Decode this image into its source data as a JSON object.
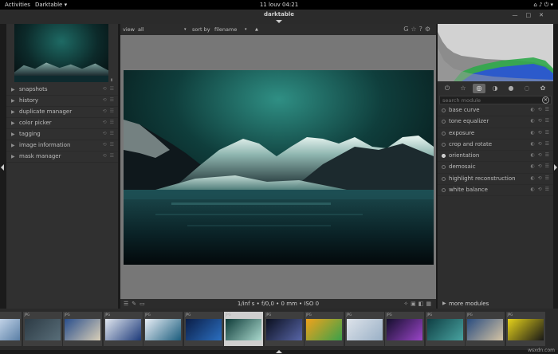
{
  "topbar": {
    "activities": "Activities",
    "app_menu": "Darktable",
    "clock": "11 louv  04:21",
    "tray_icons": [
      "network-icon",
      "volume-icon",
      "power-icon"
    ]
  },
  "window": {
    "title": "darktable",
    "buttons": [
      "minimize-icon",
      "maximize-icon",
      "close-icon"
    ]
  },
  "left_panel": {
    "modules": [
      {
        "label": "snapshots"
      },
      {
        "label": "history"
      },
      {
        "label": "duplicate manager"
      },
      {
        "label": "color picker"
      },
      {
        "label": "tagging"
      },
      {
        "label": "image information"
      },
      {
        "label": "mask manager"
      }
    ]
  },
  "center": {
    "toolbar": {
      "view_label": "view",
      "view_value": "all",
      "sort_label": "sort by",
      "sort_value": "filename"
    },
    "exif_line": "1/inf s • f/0,0 • 0 mm • ISO 0"
  },
  "right_panel": {
    "search_placeholder": "search module",
    "group_tabs": [
      "power-icon",
      "favorites-icon",
      "base-group-icon",
      "tone-group-icon",
      "color-group-icon",
      "correct-group-icon",
      "effect-group-icon"
    ],
    "active_group": 2,
    "modules": [
      {
        "label": "base curve",
        "enabled": false
      },
      {
        "label": "tone equalizer",
        "enabled": false
      },
      {
        "label": "exposure",
        "enabled": false
      },
      {
        "label": "crop and rotate",
        "enabled": false
      },
      {
        "label": "orientation",
        "enabled": true
      },
      {
        "label": "demosaic",
        "enabled": false
      },
      {
        "label": "highlight reconstruction",
        "enabled": false
      },
      {
        "label": "white balance",
        "enabled": false
      }
    ],
    "more_modules": "more modules"
  },
  "filmstrip": {
    "active_index": 6,
    "thumbnails": [
      {
        "ext": "",
        "colors": [
          "#e8f2ff",
          "#5a7fa6"
        ]
      },
      {
        "ext": "JPG",
        "colors": [
          "#2d3b45",
          "#586d78"
        ]
      },
      {
        "ext": "JPG",
        "colors": [
          "#2a4f8c",
          "#d9cfb8"
        ]
      },
      {
        "ext": "JPG",
        "colors": [
          "#e0e6ee",
          "#1d3a7a"
        ]
      },
      {
        "ext": "JPG",
        "colors": [
          "#e8eef6",
          "#1b5d7d"
        ]
      },
      {
        "ext": "JPG",
        "colors": [
          "#0b1e48",
          "#2b6fc0"
        ]
      },
      {
        "ext": "JPG",
        "colors": [
          "#0f3c3a",
          "#a9d8cc"
        ]
      },
      {
        "ext": "JPG",
        "colors": [
          "#0b1020",
          "#5866a8"
        ]
      },
      {
        "ext": "JPG",
        "colors": [
          "#f0a21c",
          "#3aa14a"
        ]
      },
      {
        "ext": "JPG",
        "colors": [
          "#dde3ea",
          "#9ab0c6"
        ]
      },
      {
        "ext": "JPG",
        "colors": [
          "#160f2e",
          "#9a45c8"
        ]
      },
      {
        "ext": "JPG",
        "colors": [
          "#0f3f44",
          "#48a3a0"
        ]
      },
      {
        "ext": "JPG",
        "colors": [
          "#2a4d80",
          "#d5c4a4"
        ]
      },
      {
        "ext": "JPG",
        "colors": [
          "#e5d21a",
          "#181818"
        ]
      }
    ]
  },
  "watermark": "wsxdn.com"
}
